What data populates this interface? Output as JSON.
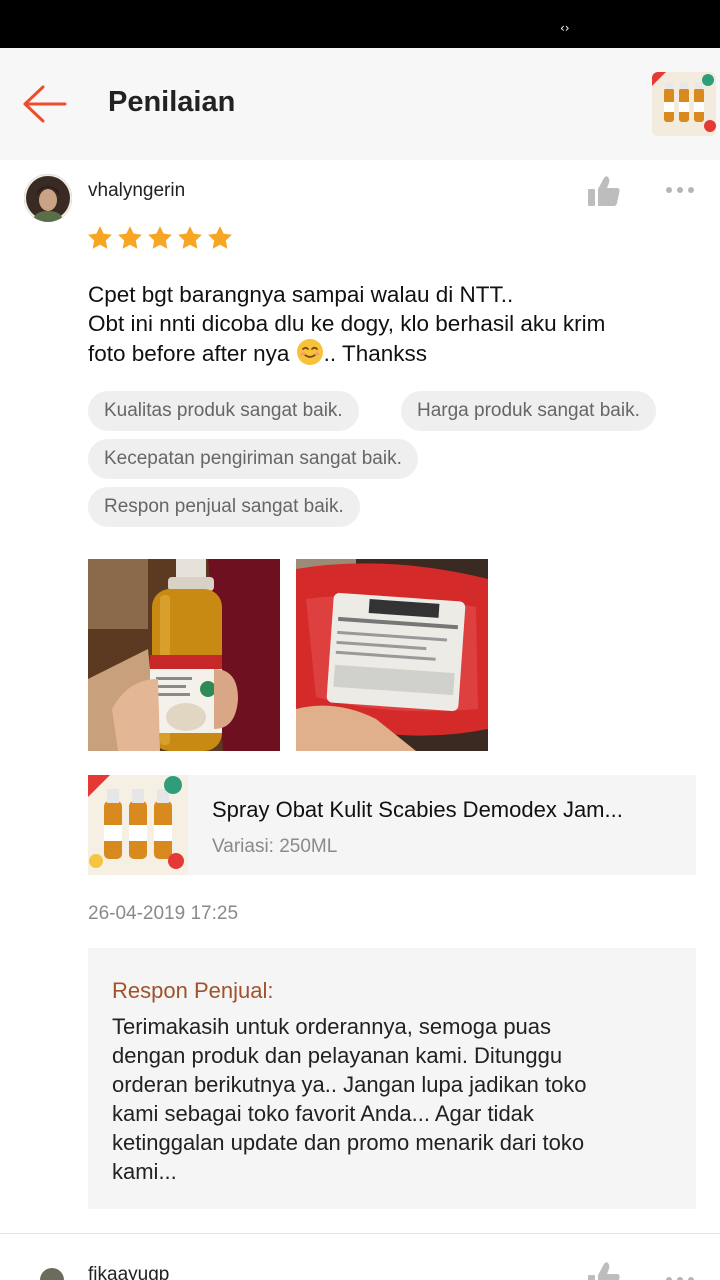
{
  "status_bar": {
    "icon": "‹›"
  },
  "header": {
    "title": "Penilaian",
    "back_icon": "arrow-left-icon",
    "accent_color": "#ee4d2d"
  },
  "review": {
    "username": "vhalyngerin",
    "rating": 5,
    "rating_max": 5,
    "text_lines": [
      "Cpet bgt barangnya sampai walau di NTT..",
      "Obt ini nnti dicoba dlu ke dogy, klo berhasil aku krim",
      "foto before after nya",
      ".. Thankss"
    ],
    "tags": [
      "Kualitas produk sangat baik.",
      "Harga produk sangat baik.",
      "Kecepatan pengiriman sangat baik.",
      "Respon penjual sangat baik."
    ],
    "product": {
      "name": "Spray Obat Kulit Scabies Demodex Jam...",
      "variation_label": "Variasi:",
      "variation_value": "250ML"
    },
    "date": "26-04-2019 17:25",
    "seller_response": {
      "title": "Respon Penjual:",
      "lines": [
        "Terimakasih untuk orderannya, semoga puas",
        "dengan produk dan pelayanan kami. Ditunggu",
        "orderan berikutnya ya.. Jangan lupa jadikan toko",
        "kami sebagai toko favorit Anda... Agar tidak",
        "ketinggalan update dan promo menarik dari toko",
        "kami..."
      ]
    }
  },
  "next_review": {
    "username": "fikaayugp"
  },
  "colors": {
    "star": "#f6a623",
    "tag_bg": "#efefef",
    "seller_title": "#a0522d"
  }
}
